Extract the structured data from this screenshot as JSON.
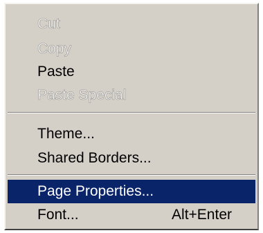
{
  "context_menu": {
    "groups": [
      [
        {
          "label": "Cut",
          "state": "disabled"
        },
        {
          "label": "Copy",
          "state": "disabled"
        },
        {
          "label": "Paste",
          "state": "enabled"
        },
        {
          "label": "Paste Special",
          "state": "disabled"
        }
      ],
      [
        {
          "label": "Theme...",
          "state": "enabled"
        },
        {
          "label": "Shared Borders...",
          "state": "enabled"
        }
      ],
      [
        {
          "label": "Page Properties...",
          "state": "selected"
        },
        {
          "label": "Font...",
          "state": "enabled",
          "shortcut": "Alt+Enter"
        }
      ]
    ]
  },
  "colors": {
    "menu_background": "#d4d0c8",
    "highlight_background": "#0a246a",
    "highlight_text": "#ffffff",
    "disabled_text": "#ffffff",
    "disabled_outline": "#8c8a86"
  }
}
